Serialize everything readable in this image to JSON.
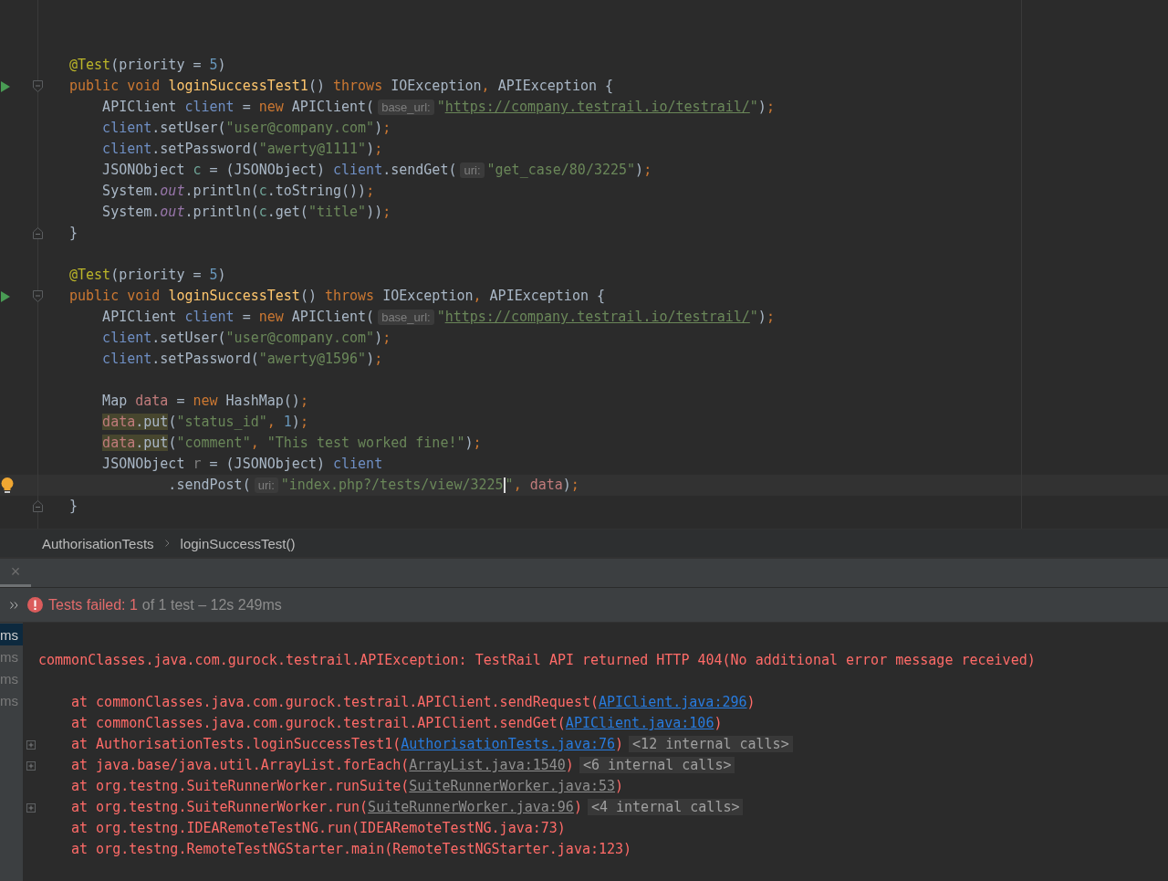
{
  "editor": {
    "blocks": [
      {
        "lines": [
          {
            "tokens": [
              {
                "kind": "annotation",
                "text": "@Test"
              },
              {
                "kind": "plain",
                "text": "(priority = "
              },
              {
                "kind": "number",
                "text": "5"
              },
              {
                "kind": "plain",
                "text": ")"
              }
            ]
          },
          {
            "run": true,
            "fold_start": true,
            "tokens": [
              {
                "kind": "keyword",
                "text": "public void "
              },
              {
                "kind": "method",
                "text": "loginSuccessTest1"
              },
              {
                "kind": "plain",
                "text": "() "
              },
              {
                "kind": "keyword",
                "text": "throws "
              },
              {
                "kind": "plain",
                "text": "IOException"
              },
              {
                "kind": "keyword",
                "text": ", "
              },
              {
                "kind": "plain",
                "text": "APIException {"
              }
            ]
          },
          {
            "tokens": [
              {
                "kind": "plain",
                "text": "    APIClient "
              },
              {
                "kind": "var",
                "text": "client"
              },
              {
                "kind": "plain",
                "text": " = "
              },
              {
                "kind": "keyword",
                "text": "new "
              },
              {
                "kind": "plain",
                "text": "APIClient("
              },
              {
                "kind": "hint",
                "text": "base_url:"
              },
              {
                "kind": "string",
                "text": "\""
              },
              {
                "kind": "link",
                "text": "https://company.testrail.io/testrail/"
              },
              {
                "kind": "string",
                "text": "\""
              },
              {
                "kind": "plain",
                "text": ")"
              },
              {
                "kind": "keyword",
                "text": ";"
              }
            ]
          },
          {
            "tokens": [
              {
                "kind": "var",
                "text": "    client"
              },
              {
                "kind": "plain",
                "text": ".setUser("
              },
              {
                "kind": "string",
                "text": "\"user@company.com\""
              },
              {
                "kind": "plain",
                "text": ")"
              },
              {
                "kind": "keyword",
                "text": ";"
              }
            ]
          },
          {
            "tokens": [
              {
                "kind": "var",
                "text": "    client"
              },
              {
                "kind": "plain",
                "text": ".setPassword("
              },
              {
                "kind": "string",
                "text": "\"awerty@1111\""
              },
              {
                "kind": "plain",
                "text": ")"
              },
              {
                "kind": "keyword",
                "text": ";"
              }
            ]
          },
          {
            "tokens": [
              {
                "kind": "plain",
                "text": "    JSONObject "
              },
              {
                "kind": "local",
                "text": "c"
              },
              {
                "kind": "plain",
                "text": " = (JSONObject) "
              },
              {
                "kind": "var",
                "text": "client"
              },
              {
                "kind": "plain",
                "text": ".sendGet("
              },
              {
                "kind": "hint",
                "text": "uri:"
              },
              {
                "kind": "string",
                "text": "\"get_case/80/3225\""
              },
              {
                "kind": "plain",
                "text": ")"
              },
              {
                "kind": "keyword",
                "text": ";"
              }
            ]
          },
          {
            "tokens": [
              {
                "kind": "plain",
                "text": "    System."
              },
              {
                "kind": "field",
                "text": "out"
              },
              {
                "kind": "plain",
                "text": ".println("
              },
              {
                "kind": "local",
                "text": "c"
              },
              {
                "kind": "plain",
                "text": ".toString())"
              },
              {
                "kind": "keyword",
                "text": ";"
              }
            ]
          },
          {
            "tokens": [
              {
                "kind": "plain",
                "text": "    System."
              },
              {
                "kind": "field",
                "text": "out"
              },
              {
                "kind": "plain",
                "text": ".println("
              },
              {
                "kind": "local",
                "text": "c"
              },
              {
                "kind": "plain",
                "text": ".get("
              },
              {
                "kind": "string",
                "text": "\"title\""
              },
              {
                "kind": "plain",
                "text": "))"
              },
              {
                "kind": "keyword",
                "text": ";"
              }
            ]
          },
          {
            "fold_end": true,
            "tokens": [
              {
                "kind": "plain",
                "text": "}"
              }
            ]
          }
        ]
      },
      {
        "lines": [
          {
            "tokens": [
              {
                "kind": "annotation",
                "text": "@Test"
              },
              {
                "kind": "plain",
                "text": "(priority = "
              },
              {
                "kind": "number",
                "text": "5"
              },
              {
                "kind": "plain",
                "text": ")"
              }
            ]
          },
          {
            "run": true,
            "fold_start": true,
            "tokens": [
              {
                "kind": "keyword",
                "text": "public void "
              },
              {
                "kind": "method",
                "text": "loginSuccessTest"
              },
              {
                "kind": "plain",
                "text": "() "
              },
              {
                "kind": "keyword",
                "text": "throws "
              },
              {
                "kind": "plain",
                "text": "IOException"
              },
              {
                "kind": "keyword",
                "text": ", "
              },
              {
                "kind": "plain",
                "text": "APIException {"
              }
            ]
          },
          {
            "tokens": [
              {
                "kind": "plain",
                "text": "    APIClient "
              },
              {
                "kind": "var",
                "text": "client"
              },
              {
                "kind": "plain",
                "text": " = "
              },
              {
                "kind": "keyword",
                "text": "new "
              },
              {
                "kind": "plain",
                "text": "APIClient("
              },
              {
                "kind": "hint",
                "text": "base_url:"
              },
              {
                "kind": "string",
                "text": "\""
              },
              {
                "kind": "link",
                "text": "https://company.testrail.io/testrail/"
              },
              {
                "kind": "string",
                "text": "\""
              },
              {
                "kind": "plain",
                "text": ")"
              },
              {
                "kind": "keyword",
                "text": ";"
              }
            ]
          },
          {
            "tokens": [
              {
                "kind": "var",
                "text": "    client"
              },
              {
                "kind": "plain",
                "text": ".setUser("
              },
              {
                "kind": "string",
                "text": "\"user@company.com\""
              },
              {
                "kind": "plain",
                "text": ")"
              },
              {
                "kind": "keyword",
                "text": ";"
              }
            ]
          },
          {
            "tokens": [
              {
                "kind": "var",
                "text": "    client"
              },
              {
                "kind": "plain",
                "text": ".setPassword("
              },
              {
                "kind": "string",
                "text": "\"awerty@1596\""
              },
              {
                "kind": "plain",
                "text": ")"
              },
              {
                "kind": "keyword",
                "text": ";"
              }
            ]
          }
        ]
      },
      {
        "lines": [
          {
            "tokens": [
              {
                "kind": "plain",
                "text": "    Map "
              },
              {
                "kind": "param",
                "text": "data"
              },
              {
                "kind": "plain",
                "text": " = "
              },
              {
                "kind": "keyword",
                "text": "new "
              },
              {
                "kind": "plain",
                "text": "HashMap()"
              },
              {
                "kind": "keyword",
                "text": ";"
              }
            ]
          },
          {
            "tokens": [
              {
                "kind": "indent_warn",
                "text": "    data"
              },
              {
                "kind": "plain_warn",
                "text": ".put"
              },
              {
                "kind": "plain",
                "text": "("
              },
              {
                "kind": "string",
                "text": "\"status_id\""
              },
              {
                "kind": "keyword",
                "text": ", "
              },
              {
                "kind": "number",
                "text": "1"
              },
              {
                "kind": "plain",
                "text": ")"
              },
              {
                "kind": "keyword",
                "text": ";"
              }
            ]
          },
          {
            "tokens": [
              {
                "kind": "indent_warn",
                "text": "    data"
              },
              {
                "kind": "plain_warn",
                "text": ".put"
              },
              {
                "kind": "plain",
                "text": "("
              },
              {
                "kind": "string",
                "text": "\"comment\""
              },
              {
                "kind": "keyword",
                "text": ", "
              },
              {
                "kind": "string",
                "text": "\"This test worked fine!\""
              },
              {
                "kind": "plain",
                "text": ")"
              },
              {
                "kind": "keyword",
                "text": ";"
              }
            ]
          },
          {
            "tokens": [
              {
                "kind": "plain",
                "text": "    JSONObject "
              },
              {
                "kind": "unused",
                "text": "r"
              },
              {
                "kind": "plain",
                "text": " = (JSONObject) "
              },
              {
                "kind": "var",
                "text": "client"
              }
            ]
          },
          {
            "bulb": true,
            "current": true,
            "tokens": [
              {
                "kind": "plain",
                "text": "            .sendPost("
              },
              {
                "kind": "hint",
                "text": "uri:"
              },
              {
                "kind": "string",
                "text": "\"index.php?/tests/view/3225"
              },
              {
                "kind": "caret"
              },
              {
                "kind": "string",
                "text": "\""
              },
              {
                "kind": "keyword",
                "text": ", "
              },
              {
                "kind": "param",
                "text": "data"
              },
              {
                "kind": "plain",
                "text": ")"
              },
              {
                "kind": "keyword",
                "text": ";"
              }
            ]
          },
          {
            "fold_end": true,
            "tokens": [
              {
                "kind": "plain",
                "text": "}"
              }
            ]
          }
        ]
      }
    ]
  },
  "breadcrumb": [
    "AuthorisationTests",
    "loginSuccessTest()"
  ],
  "tool_window": {
    "close": "×",
    "status": {
      "failed_label": "Tests failed: 1",
      "summary": "of 1 test – 12s 249ms"
    },
    "tree_items": [
      {
        "text": "ms",
        "selected": true
      },
      {
        "text": "ms",
        "selected": false
      },
      {
        "text": "ms",
        "selected": false
      },
      {
        "text": "ms",
        "selected": false
      }
    ],
    "console": {
      "error": "commonClasses.java.com.gurock.testrail.APIException: TestRail API returned HTTP 404(No additional error message received)",
      "trace": [
        {
          "parts": [
            {
              "kind": "text",
              "text": "at commonClasses.java.com.gurock.testrail.APIClient.sendRequest("
            },
            {
              "kind": "link",
              "text": "APIClient.java:296"
            },
            {
              "kind": "text",
              "text": ")"
            }
          ]
        },
        {
          "parts": [
            {
              "kind": "text",
              "text": "at commonClasses.java.com.gurock.testrail.APIClient.sendGet("
            },
            {
              "kind": "link",
              "text": "APIClient.java:106"
            },
            {
              "kind": "text",
              "text": ")"
            }
          ]
        },
        {
          "expandable": true,
          "parts": [
            {
              "kind": "text",
              "text": "at AuthorisationTests.loginSuccessTest1("
            },
            {
              "kind": "link",
              "text": "AuthorisationTests.java:76"
            },
            {
              "kind": "text",
              "text": ")"
            },
            {
              "kind": "folded",
              "text": "<12 internal calls>"
            }
          ]
        },
        {
          "expandable": true,
          "parts": [
            {
              "kind": "text",
              "text": "at java.base/java.util.ArrayList.forEach("
            },
            {
              "kind": "lib_link",
              "text": "ArrayList.java:1540"
            },
            {
              "kind": "text",
              "text": ")"
            },
            {
              "kind": "folded",
              "text": "<6 internal calls>"
            }
          ]
        },
        {
          "parts": [
            {
              "kind": "text",
              "text": "at org.testng.SuiteRunnerWorker.runSuite("
            },
            {
              "kind": "lib_link",
              "text": "SuiteRunnerWorker.java:53"
            },
            {
              "kind": "text",
              "text": ")"
            }
          ]
        },
        {
          "expandable": true,
          "parts": [
            {
              "kind": "text",
              "text": "at org.testng.SuiteRunnerWorker.run("
            },
            {
              "kind": "lib_link",
              "text": "SuiteRunnerWorker.java:96"
            },
            {
              "kind": "text",
              "text": ")"
            },
            {
              "kind": "folded",
              "text": "<4 internal calls>"
            }
          ]
        },
        {
          "parts": [
            {
              "kind": "text",
              "text": "at org.testng.IDEARemoteTestNG.run(IDEARemoteTestNG.java:73)"
            }
          ]
        },
        {
          "parts": [
            {
              "kind": "text",
              "text": "at org.testng.RemoteTestNGStarter.main(RemoteTestNGStarter.java:123)"
            }
          ]
        }
      ]
    }
  }
}
